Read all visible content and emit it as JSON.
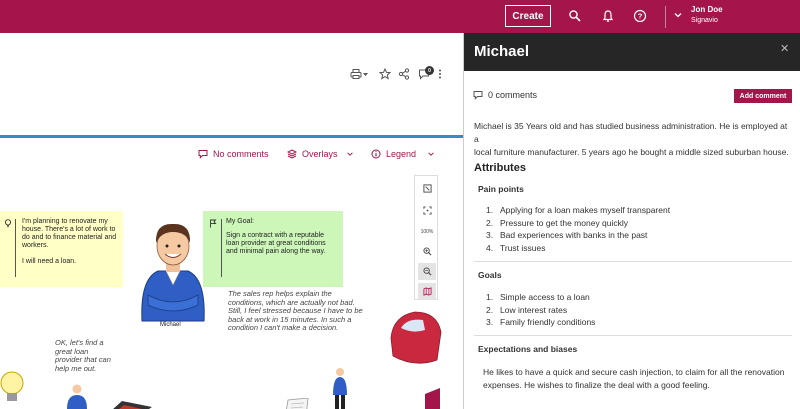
{
  "topbar": {
    "create_label": "Create",
    "user_name": "Jon Doe",
    "user_org": "Signavio",
    "brand_color": "#a3154b",
    "icons": [
      "search-icon",
      "bell-icon",
      "help-icon",
      "chevron-down-icon"
    ]
  },
  "toolbar": {
    "icons": [
      "print-icon",
      "star-icon",
      "share-icon",
      "comment-icon",
      "more-icon"
    ],
    "comment_badge": "0"
  },
  "canvas_controls": {
    "comments_label": "No comments",
    "overlays_label": "Overlays",
    "legend_label": "Legend"
  },
  "zoom": {
    "level": "100%",
    "icons": [
      "fit-screen-icon",
      "center-icon",
      "zoom-in-icon",
      "zoom-out-icon",
      "map-icon"
    ]
  },
  "canvas": {
    "note_left": {
      "line1": "I'm planning to renovate my",
      "line2": "house. There's a lot of work to",
      "line3": "do and to finance material and",
      "line4": "workers.",
      "line5": "I will need a loan."
    },
    "note_right": {
      "title": "My Goal:",
      "line1": "Sign a contract with a reputable",
      "line2": "loan provider at great conditions",
      "line3": "and minimal pain along the way."
    },
    "person_label": "Michael",
    "script_right": [
      "The sales rep helps explain the",
      "conditions, which are actually not bad.",
      "Still, I feel stressed because I have to be",
      "back at work in 15 minutes. In such a",
      "condition I can't make a decision."
    ],
    "script_left": [
      "OK, let's find a",
      "great loan",
      "provider that can",
      "help me out."
    ]
  },
  "panel": {
    "title": "Michael",
    "comments_count": "0 comments",
    "add_comment_label": "Add comment",
    "description_line1": "Michael is 35 Years old and has studied business administration. He is employed at a",
    "description_line2": "local furniture manufacturer. 5 years ago he bought a middle sized suburban house.",
    "attributes_heading": "Attributes",
    "pain_points": {
      "heading": "Pain points",
      "items": [
        "Applying for a loan makes myself transparent",
        "Pressure to get the money quickly",
        "Bad experiences with banks in the past",
        "Trust issues"
      ]
    },
    "goals": {
      "heading": "Goals",
      "items": [
        "Simple access to a loan",
        "Low interest rates",
        "Family friendly conditions"
      ]
    },
    "expectations": {
      "heading": "Expectations and biases",
      "line1": "He likes to have a quick and secure cash injection, to claim for all the renovation",
      "line2": "expenses. He wishes to finalize the deal with a good feeling."
    }
  }
}
